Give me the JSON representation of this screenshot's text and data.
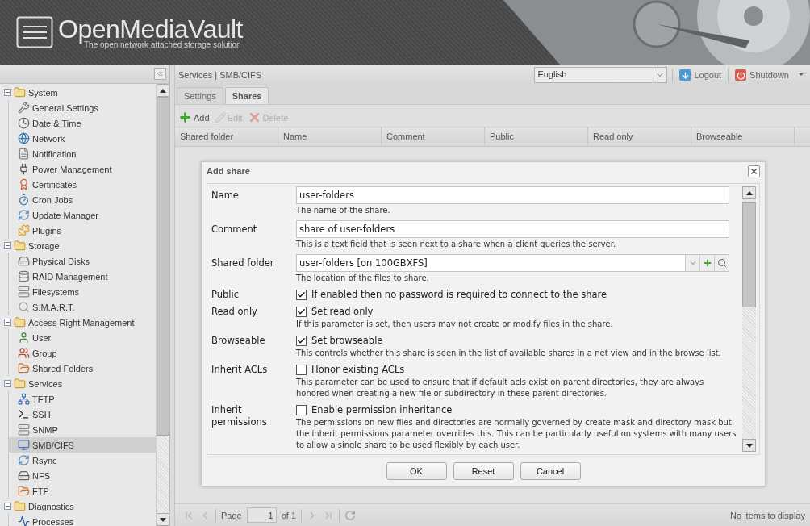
{
  "header": {
    "title": "OpenMediaVault",
    "tagline": "The open network attached storage solution"
  },
  "sidebar": {
    "tree": [
      {
        "label": "System",
        "expanded": true,
        "children": [
          {
            "label": "General Settings",
            "selected": false
          },
          {
            "label": "Date & Time",
            "selected": false
          },
          {
            "label": "Network",
            "selected": false
          },
          {
            "label": "Notification",
            "selected": false
          },
          {
            "label": "Power Management",
            "selected": false
          },
          {
            "label": "Certificates",
            "selected": false
          },
          {
            "label": "Cron Jobs",
            "selected": false
          },
          {
            "label": "Update Manager",
            "selected": false
          },
          {
            "label": "Plugins",
            "selected": false
          }
        ]
      },
      {
        "label": "Storage",
        "expanded": true,
        "children": [
          {
            "label": "Physical Disks",
            "selected": false
          },
          {
            "label": "RAID Management",
            "selected": false
          },
          {
            "label": "Filesystems",
            "selected": false
          },
          {
            "label": "S.M.A.R.T.",
            "selected": false
          }
        ]
      },
      {
        "label": "Access Right Management",
        "expanded": true,
        "children": [
          {
            "label": "User",
            "selected": false
          },
          {
            "label": "Group",
            "selected": false
          },
          {
            "label": "Shared Folders",
            "selected": false
          }
        ]
      },
      {
        "label": "Services",
        "expanded": true,
        "children": [
          {
            "label": "TFTP",
            "selected": false
          },
          {
            "label": "SSH",
            "selected": false
          },
          {
            "label": "SNMP",
            "selected": false
          },
          {
            "label": "SMB/CIFS",
            "selected": true
          },
          {
            "label": "Rsync",
            "selected": false
          },
          {
            "label": "NFS",
            "selected": false
          },
          {
            "label": "FTP",
            "selected": false
          }
        ]
      },
      {
        "label": "Diagnostics",
        "expanded": true,
        "children": [
          {
            "label": "Processes",
            "selected": false
          }
        ]
      }
    ]
  },
  "topbar": {
    "breadcrumb": "Services | SMB/CIFS",
    "language": "English",
    "logout": "Logout",
    "shutdown": "Shutdown"
  },
  "tabs": [
    {
      "label": "Settings",
      "selected": false
    },
    {
      "label": "Shares",
      "selected": true
    }
  ],
  "toolbar": [
    {
      "kind": "add",
      "label": "Add",
      "disabled": false
    },
    {
      "kind": "edit",
      "label": "Edit",
      "disabled": true
    },
    {
      "kind": "delete",
      "label": "Delete",
      "disabled": true
    }
  ],
  "grid": {
    "columns": [
      "Shared folder",
      "Name",
      "Comment",
      "Public",
      "Read only",
      "Browseable"
    ]
  },
  "paging": {
    "page_label": "Page",
    "page": "1",
    "of": "of 1",
    "status": "No items to display"
  },
  "dialog": {
    "title": "Add share",
    "fields": [
      {
        "kind": "text",
        "label": "Name",
        "value": "user-folders",
        "help": "The name of the share."
      },
      {
        "kind": "text",
        "label": "Comment",
        "value": "share of user-folders",
        "help": "This is a text field that is seen next to a share when a client queries the server."
      },
      {
        "kind": "combo",
        "label": "Shared folder",
        "value": "user-folders [on 100GBXFS]",
        "help": "The location of the files to share."
      },
      {
        "kind": "checkbox",
        "label": "Public",
        "checked": true,
        "box_label": "If enabled then no password is required to connect to the share"
      },
      {
        "kind": "checkbox",
        "label": "Read only",
        "checked": true,
        "box_label": "Set read only",
        "help": "If this parameter is set, then users may not create or modify files in the share."
      },
      {
        "kind": "checkbox",
        "label": "Browseable",
        "checked": true,
        "box_label": "Set browseable",
        "help": "This controls whether this share is seen in the list of available shares in a net view and in the browse list."
      },
      {
        "kind": "checkbox",
        "label": "Inherit ACLs",
        "checked": false,
        "box_label": "Honor existing ACLs",
        "help": "This parameter can be used to ensure that if default acls exist on parent directories, they are always honored when creating a new file or subdirectory in these parent directories."
      },
      {
        "kind": "checkbox",
        "label": "Inherit permissions",
        "checked": false,
        "box_label": "Enable permission inheritance",
        "help": "The permissions on new files and directories are normally governed by create mask and directory mask but the inherit permissions parameter overrides this. This can be particularly useful on systems with many users to allow a single share to be used flexibly by each user."
      }
    ],
    "buttons": [
      "OK",
      "Reset",
      "Cancel"
    ]
  }
}
